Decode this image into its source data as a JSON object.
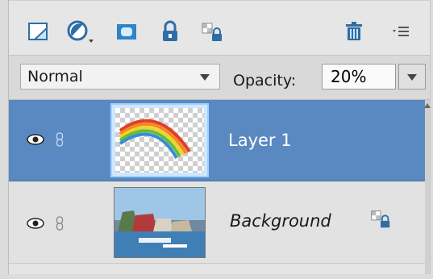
{
  "toolbar": {
    "icons": [
      "new-layer-icon",
      "adjustment-layer-icon",
      "layer-mask-icon",
      "lock-all-icon",
      "lock-transparent-icon",
      "trash-icon",
      "panel-menu-icon"
    ]
  },
  "blend": {
    "mode": "Normal",
    "opacity_label": "Opacity:",
    "opacity_value": "20%"
  },
  "layers": [
    {
      "name": "Layer 1",
      "selected": true,
      "visible": true,
      "locked": false
    },
    {
      "name": "Background",
      "selected": false,
      "visible": true,
      "locked": true
    }
  ],
  "colors": {
    "selected_row": "#5a89c2",
    "panel_bg": "#e4e4e4"
  }
}
